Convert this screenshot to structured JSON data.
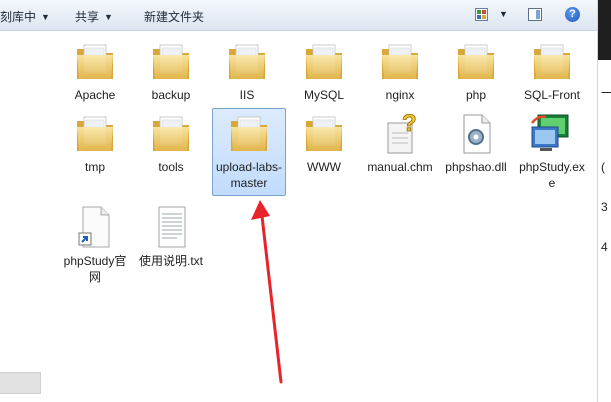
{
  "toolbar": {
    "include_in_library": "刻库中",
    "share": "共享",
    "new_folder": "新建文件夹"
  },
  "files": [
    {
      "label": "Apache",
      "icon": "folder-icon"
    },
    {
      "label": "backup",
      "icon": "folder-icon"
    },
    {
      "label": "IIS",
      "icon": "folder-icon"
    },
    {
      "label": "MySQL",
      "icon": "folder-icon"
    },
    {
      "label": "nginx",
      "icon": "folder-icon"
    },
    {
      "label": "php",
      "icon": "folder-icon"
    },
    {
      "label": "SQL-Front",
      "icon": "folder-icon"
    },
    {
      "label": "tmp",
      "icon": "folder-icon"
    },
    {
      "label": "tools",
      "icon": "folder-icon"
    },
    {
      "label": "upload-labs-master",
      "icon": "folder-icon"
    },
    {
      "label": "WWW",
      "icon": "folder-icon"
    },
    {
      "label": "manual.chm",
      "icon": "chm-help-icon"
    },
    {
      "label": "phpshao.dll",
      "icon": "dll-gear-icon"
    },
    {
      "label": "phpStudy.exe",
      "icon": "phpstudy-app-icon"
    },
    {
      "label": "phpStudy官网",
      "icon": "shortcut-icon"
    },
    {
      "label": "使用说明.txt",
      "icon": "text-file-icon"
    }
  ],
  "selected_item": "upload-labs-master",
  "right_strip": [
    "一",
    "(",
    "3",
    "4"
  ],
  "colors": {
    "accent": "#3a7bd5",
    "arrow": "#e8232a",
    "folder": "#f0cf6e"
  }
}
